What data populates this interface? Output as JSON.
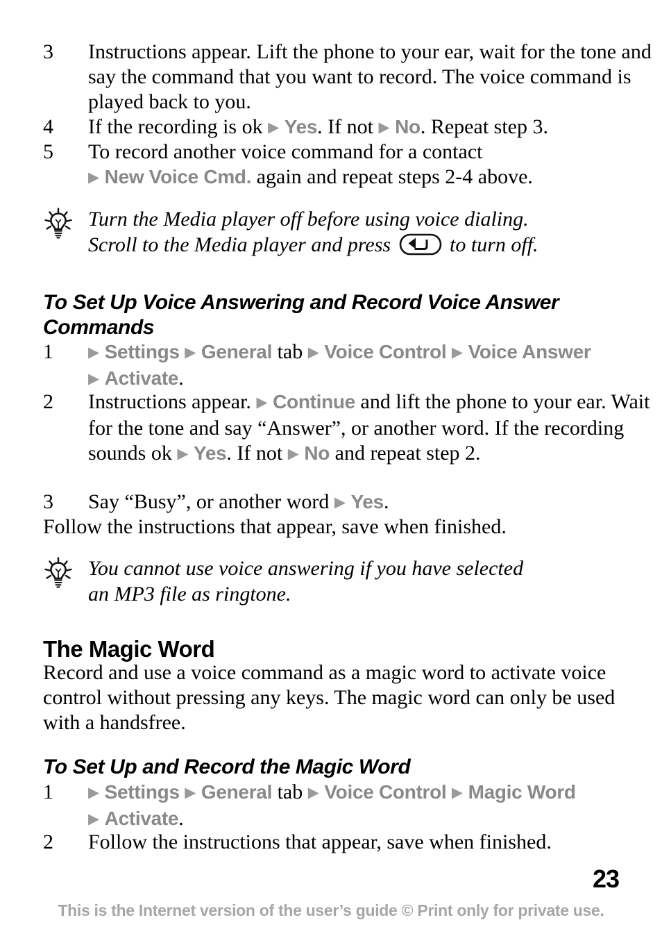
{
  "page": {
    "number": "23",
    "footer": "This is the Internet version of the user’s guide © Print only for private use.",
    "colors": {
      "text": "#000000",
      "ui_item": "#898989",
      "footer": "#a6a6a6",
      "background": "#ffffff"
    }
  },
  "steps_top": {
    "step3": {
      "num": "3",
      "text": "Instructions appear. Lift the phone to your ear, wait for the tone and say the command that you want to record. The voice command is played back to you."
    },
    "step4": {
      "num": "4",
      "text_a": "If the recording is ok",
      "ui_yes": "Yes",
      "text_b": ". If not",
      "ui_no": "No",
      "text_c": ". Repeat step 3."
    },
    "step5": {
      "num": "5",
      "text_a": "To record another voice command for a contact",
      "ui_new_voice_cmd": "New Voice Cmd.",
      "text_b": "again and repeat steps 2-4 above."
    }
  },
  "tip1": {
    "icon": "lightbulb-icon",
    "line1": "Turn the Media player off before using voice dialing.",
    "line2_a": "Scroll to the Media player and press",
    "key_icon": "back-key-icon",
    "line2_b": "to turn off."
  },
  "section_voice_answering": {
    "heading": "To Set Up Voice Answering and Record Voice Answer Commands",
    "step1": {
      "num": "1",
      "ui_settings": "Settings",
      "ui_general": "General",
      "text_tab": "tab",
      "ui_voice_control": "Voice Control",
      "ui_voice_answer": "Voice Answer",
      "ui_activate": "Activate",
      "period": "."
    },
    "step2": {
      "num": "2",
      "text_a": "Instructions appear.",
      "ui_continue": "Continue",
      "text_b": "and lift the phone to your ear. Wait for the tone and say “Answer”, or another word. If the recording sounds ok",
      "ui_yes": "Yes",
      "text_c": ". If not",
      "ui_no": "No",
      "text_d": "and repeat step 2."
    },
    "step3": {
      "num": "3",
      "text_a": "Say “Busy”, or another word",
      "ui_yes": "Yes",
      "text_b": "."
    },
    "follow": "Follow the instructions that appear, save when finished."
  },
  "tip2": {
    "icon": "lightbulb-icon",
    "line1": "You cannot use voice answering if you have selected",
    "line2": "an MP3 file as ringtone."
  },
  "section_magic_word": {
    "heading": "The Magic Word",
    "paragraph": "Record and use a voice command as a magic word to activate voice control without pressing any keys. The magic word can only be used with a handsfree.",
    "sub_heading": "To Set Up and Record the Magic Word",
    "step1": {
      "num": "1",
      "ui_settings": "Settings",
      "ui_general": "General",
      "text_tab": "tab",
      "ui_voice_control": "Voice Control",
      "ui_magic_word": "Magic Word",
      "ui_activate": "Activate",
      "period": "."
    },
    "step2": {
      "num": "2",
      "text": "Follow the instructions that appear, save when finished."
    }
  }
}
